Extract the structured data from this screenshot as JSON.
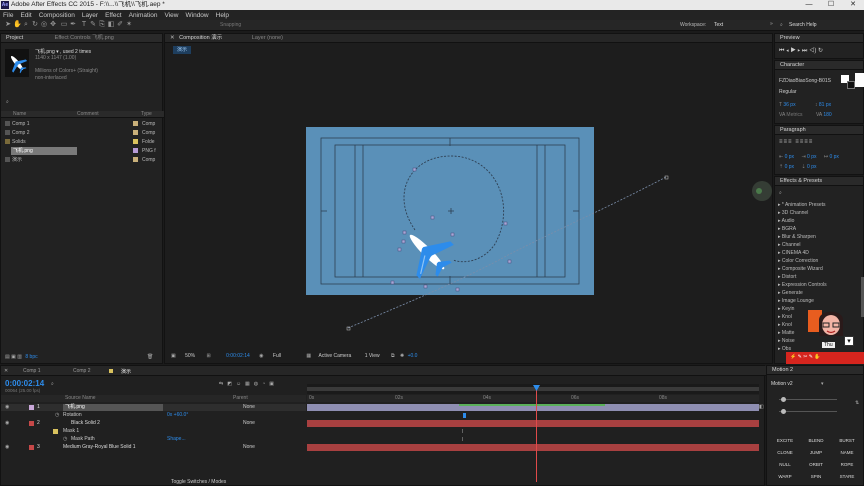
{
  "window": {
    "title": "Adobe After Effects CC 2015 - F:\\\\...\\\\飞机\\\\飞机.aep *",
    "app_icon_text": "Ae",
    "minimize": "—",
    "maximize": "☐",
    "close": "✕"
  },
  "menu": [
    "File",
    "Edit",
    "Composition",
    "Layer",
    "Effect",
    "Animation",
    "View",
    "Window",
    "Help"
  ],
  "toolbar": {
    "snapping_label": "Snapping",
    "workspace_label": "Workspace:",
    "workspace_value": "Text",
    "search_placeholder": "Search Help"
  },
  "project": {
    "tab": "Project",
    "effect_controls_tab": "Effect Controls 飞机.png",
    "asset_name": "飞机.png ▾ , used 2 times",
    "asset_dims": "1140 x 1147 (1.00)",
    "asset_colors": "Millions of Colors+ (Straight)",
    "asset_interlace": "non-interlaced",
    "col_name": "Name",
    "col_comment": "Comment",
    "col_type": "Type",
    "items": [
      {
        "name": "Comp 1",
        "type": "Comp",
        "color": "#c9b07a"
      },
      {
        "name": "Comp 2",
        "type": "Comp",
        "color": "#c9b07a"
      },
      {
        "name": "Solids",
        "type": "Folde",
        "color": "#d9c25e"
      },
      {
        "name": "飞机.png",
        "type": "PNG f",
        "color": "#b69bd6"
      },
      {
        "name": "演示",
        "type": "Comp",
        "color": "#c9b07a"
      }
    ],
    "bpc": "8 bpc"
  },
  "composition": {
    "tab": "Composition 演示",
    "layer_tab": "Layer (none)",
    "comp_chip": "演示",
    "zoom": "50%",
    "timecode": "0:00:02:14",
    "quality": "Full",
    "camera": "Active Camera",
    "views": "1 View",
    "exposure": "+0.0"
  },
  "preview": {
    "tab": "Preview"
  },
  "character": {
    "tab": "Character",
    "font": "FZDiaoBiaoSong-B01S",
    "style": "Regular",
    "size": "36 px",
    "leading": "81 px",
    "kerning": "Metrics",
    "tracking": "180"
  },
  "paragraph": {
    "tab": "Paragraph",
    "indent_left": "0 px",
    "indent_right": "0 px",
    "indent_first": "0 px",
    "space_before": "0 px",
    "space_after": "0 px"
  },
  "effects_presets": {
    "tab": "Effects & Presets",
    "items": [
      "* Animation Presets",
      "3D Channel",
      "Audio",
      "BGRA",
      "Blur & Sharpen",
      "Channel",
      "CINEMA 4D",
      "Color Correction",
      "Composite Wizard",
      "Distort",
      "Expression Controls",
      "Generate",
      "Image Lounge",
      "Keyin",
      "Knol",
      "Knol",
      "Matte",
      "Noise",
      "Obs"
    ]
  },
  "timeline": {
    "tabs": [
      "Comp 1",
      "Comp 2",
      "演示"
    ],
    "timecode": "0:00:02:14",
    "frame_info": "00064 (25.00 fps)",
    "col_source": "Source Name",
    "col_parent": "Parent",
    "ruler": [
      "0s",
      "02s",
      "04s",
      "06s",
      "08s"
    ],
    "layers": [
      {
        "num": "1",
        "name": "飞机.png",
        "parent": "None",
        "color": "#c9a7d9"
      },
      {
        "num": "",
        "name": "Rotation",
        "value": "0x +60.0°",
        "color": ""
      },
      {
        "num": "2",
        "name": "Black Solid 2",
        "parent": "None",
        "color": "#c64848"
      },
      {
        "num": "",
        "name": "Mask 1",
        "value": "",
        "color": ""
      },
      {
        "num": "",
        "name": "Mask Path",
        "value": "Shape...",
        "color": ""
      },
      {
        "num": "3",
        "name": "Medium Gray-Royal Blue Solid 1",
        "parent": "None",
        "color": "#c64848"
      }
    ],
    "toggle": "Toggle Switches / Modes"
  },
  "motion": {
    "tab": "Motion 2",
    "preset": "Motion v2",
    "buttons": [
      "EXCITE",
      "BLEND",
      "BURST",
      "CLONE",
      "JUMP",
      "NAME",
      "NULL",
      "ORBIT",
      "ROPE",
      "WARP",
      "SPIN",
      "STARE"
    ]
  },
  "overlay": {
    "label": "Thu"
  },
  "colors": {
    "accent": "#2d8ceb",
    "comp_bg": "#5a90b8",
    "timecode": "#2d8ceb",
    "playhead": "#e04a4a"
  }
}
